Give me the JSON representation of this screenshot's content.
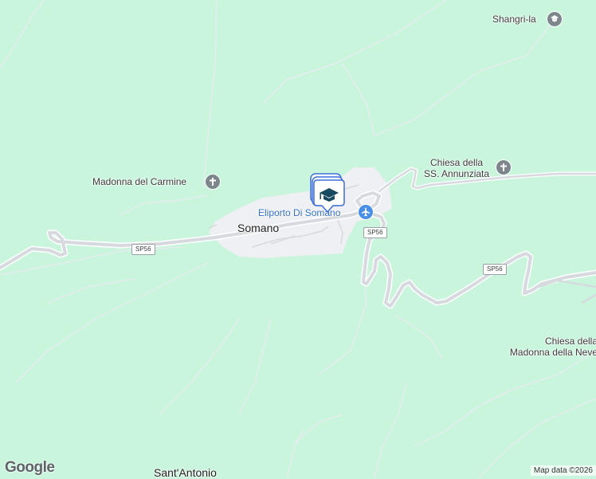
{
  "map": {
    "colors": {
      "land": "#c8f5dc",
      "urban": "#eef0f3",
      "road": "#d6dade",
      "road_casing": "#ffffff",
      "trail": "#e4e9ec",
      "label_text": "#3c3c3c",
      "airport_label": "#3370c9",
      "marker": "#3d6fd9"
    },
    "places": {
      "town": "Somano",
      "village_south": "Sant'Antonio",
      "shangri_la": "Shangri-la",
      "madonna_carmine": "Madonna del Carmine",
      "chiesa_annunziata_line1": "Chiesa della",
      "chiesa_annunziata_line2": "SS. Annunziata",
      "chiesa_neve_line1": "Chiesa della",
      "chiesa_neve_line2": "Madonna della Neve",
      "heliport": "Eliporto Di Somano"
    },
    "road_shields": {
      "west": "SP56",
      "center": "SP56",
      "east": "SP56"
    },
    "icons": {
      "shangri_la": "school-icon",
      "madonna_carmine": "church-cross-icon",
      "chiesa_annunziata": "church-cross-icon",
      "heliport": "airport-plane-icon",
      "marker": "education-marker-icon"
    },
    "attribution": "Map data ©2026",
    "logo": "Google"
  }
}
